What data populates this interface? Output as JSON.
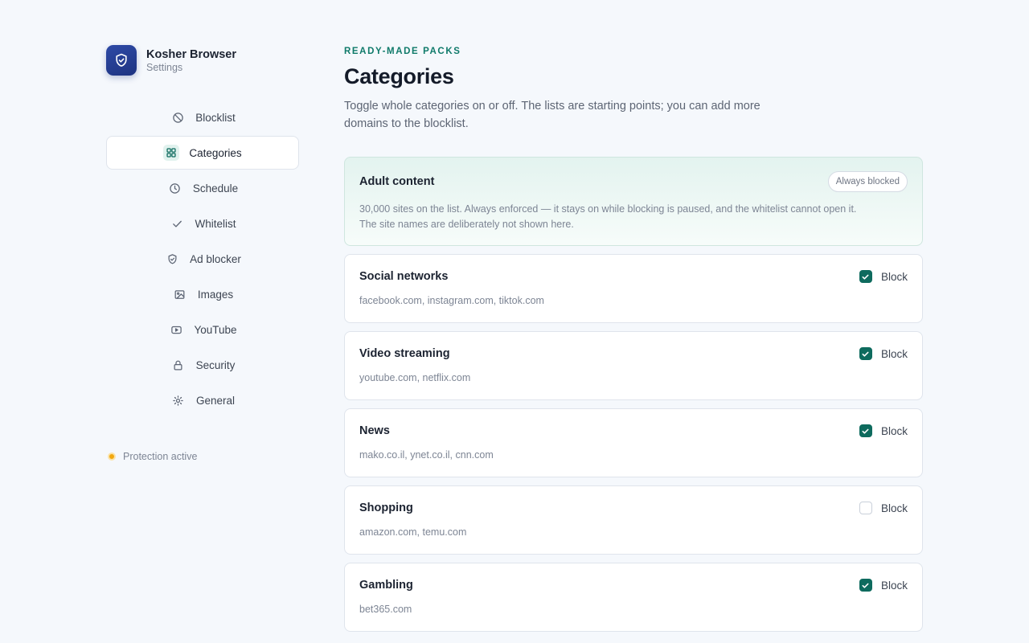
{
  "brand": {
    "title": "Kosher Browser",
    "subtitle": "Settings"
  },
  "nav": [
    {
      "label": "Blocklist",
      "icon": "ban-icon"
    },
    {
      "label": "Categories",
      "icon": "grid-icon",
      "active": true
    },
    {
      "label": "Schedule",
      "icon": "clock-icon"
    },
    {
      "label": "Whitelist",
      "icon": "check-icon"
    },
    {
      "label": "Ad blocker",
      "icon": "shield-check-icon"
    },
    {
      "label": "Images",
      "icon": "image-icon"
    },
    {
      "label": "YouTube",
      "icon": "play-icon"
    },
    {
      "label": "Security",
      "icon": "lock-icon"
    },
    {
      "label": "General",
      "icon": "sun-icon"
    }
  ],
  "status": {
    "label": "Protection active",
    "color": "#f2a80f"
  },
  "main": {
    "eyebrow": "READY-MADE PACKS",
    "title": "Categories",
    "description": "Toggle whole categories on or off. The lists are starting points; you can add more domains to the blocklist."
  },
  "adult": {
    "title": "Adult content",
    "badge": "Always blocked",
    "description_line1": "30,000 sites on the list. Always enforced — it stays on while blocking is paused, and the whitelist cannot open it.",
    "description_line2": "The site names are deliberately not shown here."
  },
  "categories": [
    {
      "title": "Social networks",
      "domains": "facebook.com, instagram.com, tiktok.com",
      "toggle_label": "Block",
      "checked": true
    },
    {
      "title": "Video streaming",
      "domains": "youtube.com, netflix.com",
      "toggle_label": "Block",
      "checked": true
    },
    {
      "title": "News",
      "domains": "mako.co.il, ynet.co.il, cnn.com",
      "toggle_label": "Block",
      "checked": true
    },
    {
      "title": "Shopping",
      "domains": "amazon.com, temu.com",
      "toggle_label": "Block",
      "checked": false
    },
    {
      "title": "Gambling",
      "domains": "bet365.com",
      "toggle_label": "Block",
      "checked": true
    }
  ],
  "colors": {
    "accent": "#0e6b5e",
    "eyebrow": "#0f7a6a",
    "brand": "#2e4aa6"
  }
}
